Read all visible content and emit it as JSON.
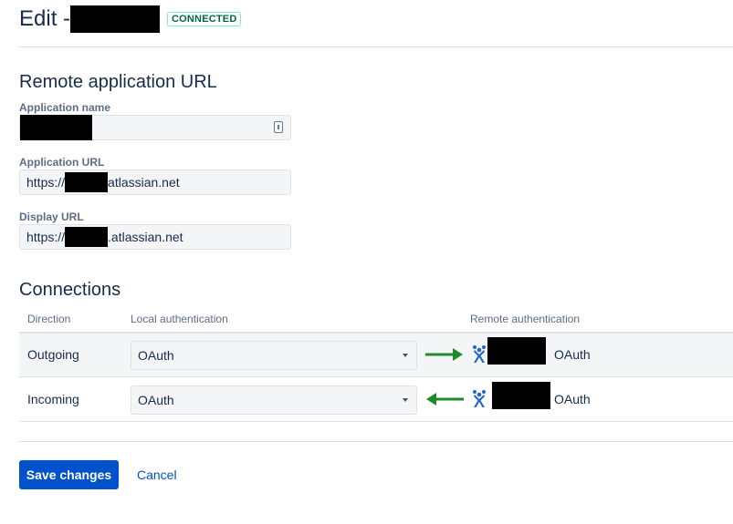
{
  "header": {
    "title_prefix": "Edit -",
    "status": "CONNECTED"
  },
  "remote": {
    "section_title": "Remote application URL",
    "app_name": {
      "label": "Application name",
      "value": ""
    },
    "app_url": {
      "label": "Application URL",
      "prefix": "https://",
      "suffix": "atlassian.net"
    },
    "display_url": {
      "label": "Display URL",
      "prefix": "https://",
      "suffix": ".atlassian.net"
    }
  },
  "connections": {
    "section_title": "Connections",
    "columns": {
      "direction": "Direction",
      "local": "Local authentication",
      "remote": "Remote authentication"
    },
    "rows": [
      {
        "direction": "Outgoing",
        "local": "OAuth",
        "remote": "OAuth",
        "arrow": "right"
      },
      {
        "direction": "Incoming",
        "local": "OAuth",
        "remote": "OAuth",
        "arrow": "left"
      }
    ]
  },
  "actions": {
    "save": "Save changes",
    "cancel": "Cancel"
  },
  "colors": {
    "primary": "#0052cc",
    "connected_text": "#006644",
    "arrow": "#1f8a2c",
    "jira_icon": "#2166c9"
  },
  "icons": {
    "field_icon": "id-card-icon",
    "arrow_right": "arrow-right-icon",
    "arrow_left": "arrow-left-icon",
    "app_icon": "jira-icon",
    "select_caret": "chevron-down-icon"
  }
}
